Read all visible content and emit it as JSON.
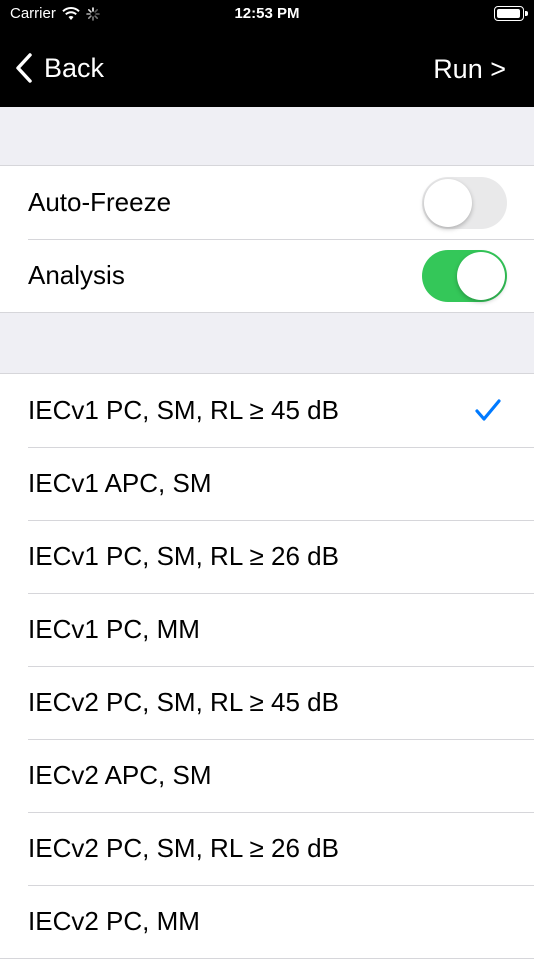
{
  "status": {
    "carrier": "Carrier",
    "time": "12:53 PM",
    "battery_level": 0.95
  },
  "nav": {
    "back_label": "Back",
    "run_label": "Run >"
  },
  "settings": [
    {
      "label": "Auto-Freeze",
      "enabled": false
    },
    {
      "label": "Analysis",
      "enabled": true
    }
  ],
  "standards": {
    "selected_index": 0,
    "items": [
      "IECv1 PC, SM, RL ≥ 45 dB",
      "IECv1 APC, SM",
      "IECv1 PC, SM, RL ≥ 26 dB",
      "IECv1 PC, MM",
      "IECv2 PC, SM, RL ≥ 45 dB",
      "IECv2 APC, SM",
      "IECv2 PC, SM, RL ≥ 26 dB",
      "IECv2 PC, MM"
    ]
  },
  "colors": {
    "accent": "#007aff",
    "toggle_on": "#34c759",
    "toggle_off": "#e9e9ea"
  }
}
